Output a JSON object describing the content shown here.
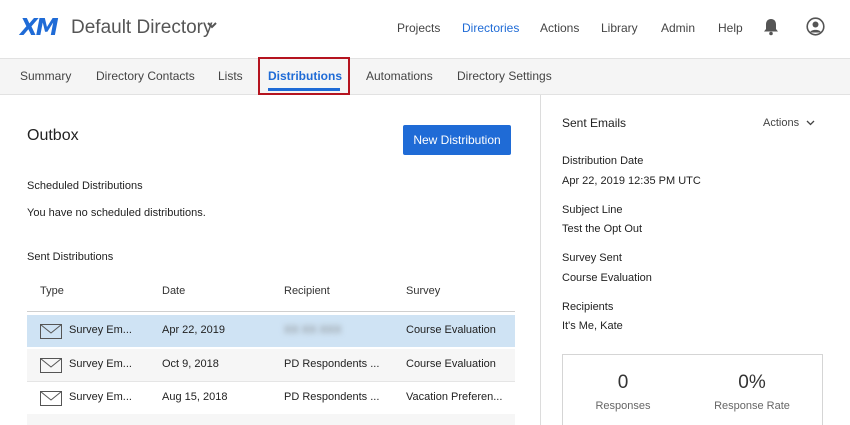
{
  "header": {
    "logo": "XM",
    "directory_title": "Default Directory",
    "nav": [
      "Projects",
      "Directories",
      "Actions",
      "Library",
      "Admin",
      "Help"
    ],
    "active_nav": "Directories"
  },
  "subnav": {
    "tabs": [
      "Summary",
      "Directory Contacts",
      "Lists",
      "Distributions",
      "Automations",
      "Directory Settings"
    ],
    "active_tab": "Distributions"
  },
  "main": {
    "title": "Outbox",
    "new_button": "New Distribution",
    "scheduled_label": "Scheduled Distributions",
    "scheduled_empty": "You have no scheduled distributions.",
    "sent_label": "Sent Distributions",
    "columns": [
      "Type",
      "Date",
      "Recipient",
      "Survey"
    ],
    "rows": [
      {
        "type": "Survey Em...",
        "date": "Apr 22, 2019",
        "recipient": "XX XX XXX",
        "survey": "Course Evaluation",
        "selected": true
      },
      {
        "type": "Survey Em...",
        "date": "Oct 9, 2018",
        "recipient": "PD Respondents ...",
        "survey": "Course Evaluation",
        "selected": false
      },
      {
        "type": "Survey Em...",
        "date": "Aug 15, 2018",
        "recipient": "PD Respondents ...",
        "survey": "Vacation Preferen...",
        "selected": false
      }
    ]
  },
  "detail": {
    "title": "Sent Emails",
    "actions_label": "Actions",
    "fields": [
      {
        "label": "Distribution Date",
        "value": "Apr 22, 2019 12:35 PM UTC"
      },
      {
        "label": "Subject Line",
        "value": "Test the Opt Out"
      },
      {
        "label": "Survey Sent",
        "value": "Course Evaluation"
      },
      {
        "label": "Recipients",
        "value": "It's Me, Kate"
      }
    ],
    "stats": {
      "responses_value": "0",
      "responses_label": "Responses",
      "rate_value": "0%",
      "rate_label": "Response Rate"
    }
  },
  "colors": {
    "accent": "#1f6bd6",
    "highlight_outline": "#b5141f",
    "selected_row": "#cfe3f4"
  }
}
